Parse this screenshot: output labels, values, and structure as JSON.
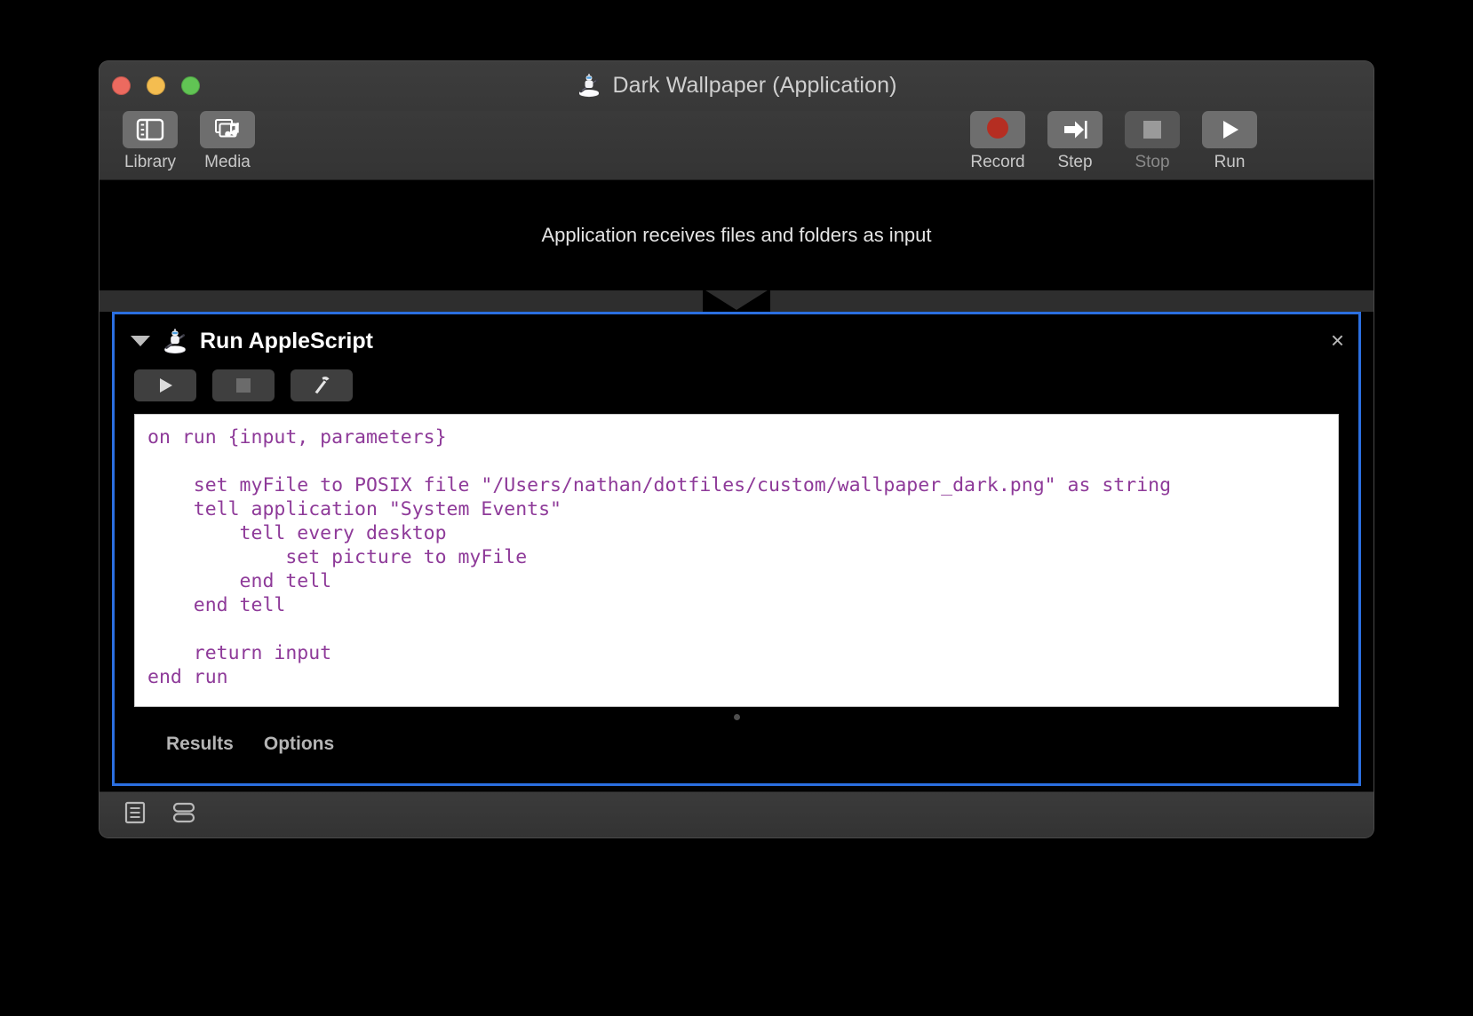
{
  "window": {
    "title": "Dark Wallpaper (Application)",
    "title_icon": "automator-robot-icon",
    "traffic_lights": {
      "close": "close-window-button",
      "minimize": "minimize-window-button",
      "zoom": "zoom-window-button"
    }
  },
  "toolbar": {
    "left_items": [
      {
        "label": "Library",
        "icon": "library-panel-icon",
        "enabled": true
      },
      {
        "label": "Media",
        "icon": "media-browser-icon",
        "enabled": true
      }
    ],
    "right_items": [
      {
        "label": "Record",
        "icon": "record-circle-icon",
        "enabled": true
      },
      {
        "label": "Step",
        "icon": "step-arrow-icon",
        "enabled": true
      },
      {
        "label": "Stop",
        "icon": "stop-square-icon",
        "enabled": false
      },
      {
        "label": "Run",
        "icon": "play-triangle-icon",
        "enabled": true
      }
    ]
  },
  "workflow": {
    "input_banner": "Application receives files and folders as input",
    "action": {
      "title": "Run AppleScript",
      "icon": "automator-robot-icon",
      "disclosure": "expanded",
      "close_label": "×",
      "buttons": [
        {
          "name": "run-script-button",
          "icon": "play-triangle-icon"
        },
        {
          "name": "stop-script-button",
          "icon": "stop-square-icon"
        },
        {
          "name": "compile-script-button",
          "icon": "hammer-icon"
        }
      ],
      "code": "on run {input, parameters}\n\n    set myFile to POSIX file \"/Users/nathan/dotfiles/custom/wallpaper_dark.png\" as string\n    tell application \"System Events\"\n        tell every desktop\n            set picture to myFile\n        end tell\n    end tell\n\n    return input\nend run",
      "tabs": [
        {
          "label": "Results"
        },
        {
          "label": "Options"
        }
      ]
    }
  },
  "statusbar": {
    "icons": [
      {
        "name": "log-view-icon"
      },
      {
        "name": "variables-view-icon"
      }
    ]
  },
  "colors": {
    "selection_blue": "#2b6fe0",
    "code_purple": "#8e3a99",
    "record_red": "#b52e22",
    "window_chrome": "#3a3a3a"
  }
}
